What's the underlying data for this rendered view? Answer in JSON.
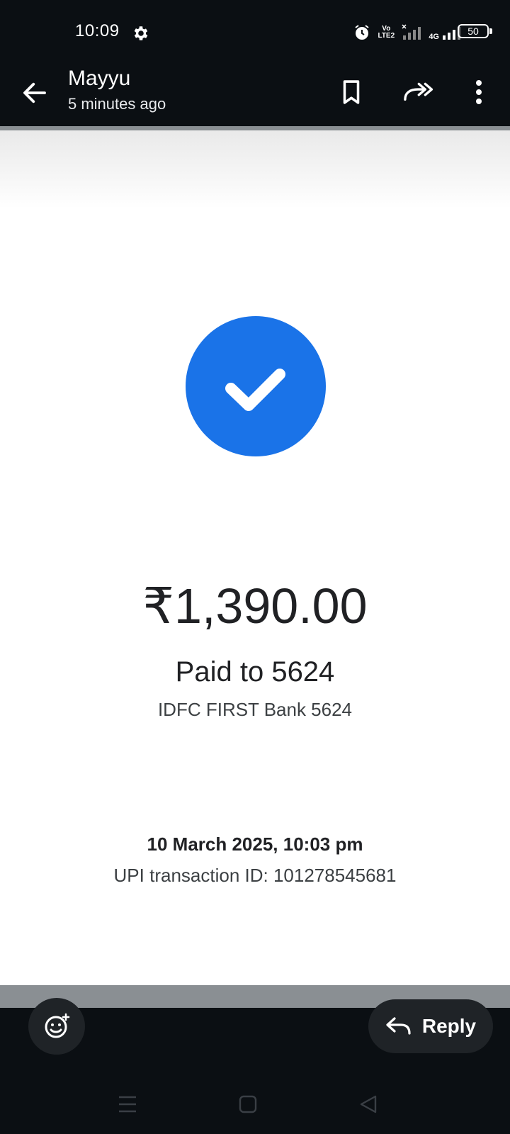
{
  "status_bar": {
    "time": "10:09",
    "network_volte": "Vo LTE2",
    "network_type": "4G",
    "battery": "50",
    "icons": [
      "gear-icon",
      "alarm-icon",
      "volte-icon",
      "signal-icon",
      "signal-4g-icon",
      "battery-icon"
    ]
  },
  "header": {
    "sender": "Mayyu",
    "time_ago": "5 minutes ago",
    "icons": [
      "back-arrow-icon",
      "bookmark-icon",
      "forward-icon",
      "more-vert-icon"
    ]
  },
  "receipt": {
    "amount": "₹1,390.00",
    "paid_to": "Paid to 5624",
    "bank": "IDFC FIRST Bank 5624",
    "datetime": "10 March 2025, 10:03 pm",
    "upi_id": "UPI transaction ID: 101278545681",
    "accent_color": "#1a73e8"
  },
  "bottom_bar": {
    "reply_label": "Reply",
    "icons": [
      "emoji-add-icon",
      "reply-icon"
    ]
  },
  "nav_bar": {
    "icons": [
      "menu-icon",
      "home-icon",
      "back-triangle-icon"
    ]
  }
}
